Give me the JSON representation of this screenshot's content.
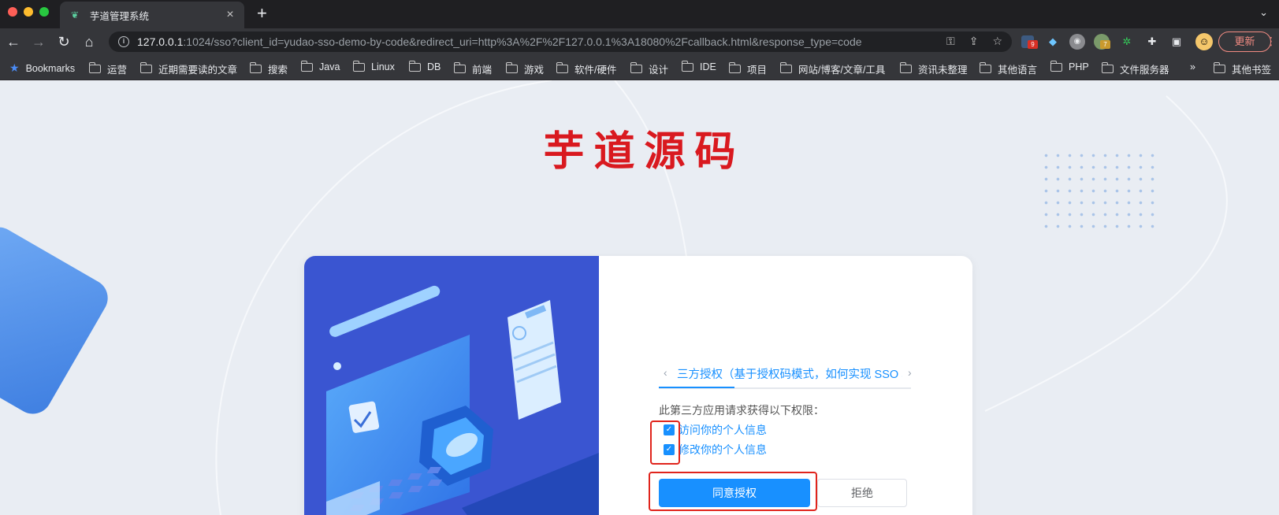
{
  "browser": {
    "tab_title": "芋道管理系统",
    "url_host": "127.0.0.1",
    "url_rest": ":1024/sso?client_id=yudao-sso-demo-by-code&redirect_uri=http%3A%2F%2F127.0.0.1%3A18080%2Fcallback.html&response_type=code",
    "update_label": "更新",
    "extension_badges": [
      "9",
      "7"
    ]
  },
  "bookmarks": {
    "items": [
      "Bookmarks",
      "运营",
      "近期需要读的文章",
      "搜索",
      "Java",
      "Linux",
      "DB",
      "前端",
      "游戏",
      "软件/硬件",
      "设计",
      "IDE",
      "项目",
      "网站/博客/文章/工具",
      "资讯未整理",
      "其他语言",
      "PHP",
      "文件服务器"
    ],
    "overflow": "»",
    "other": "其他书签"
  },
  "page": {
    "logo": "芋道源码",
    "tab_label": "三方授权（基于授权码模式，如何实现 SSO 单点登录？）",
    "permission_title": "此第三方应用请求获得以下权限：",
    "permissions": [
      {
        "label": "访问你的个人信息",
        "checked": true
      },
      {
        "label": "修改你的个人信息",
        "checked": true
      }
    ],
    "agree_label": "同意授权",
    "reject_label": "拒绝"
  },
  "colors": {
    "accent": "#1890ff",
    "logo": "#d9191f",
    "highlight": "#e0241c",
    "illustration_bg": "#3a55d1"
  }
}
